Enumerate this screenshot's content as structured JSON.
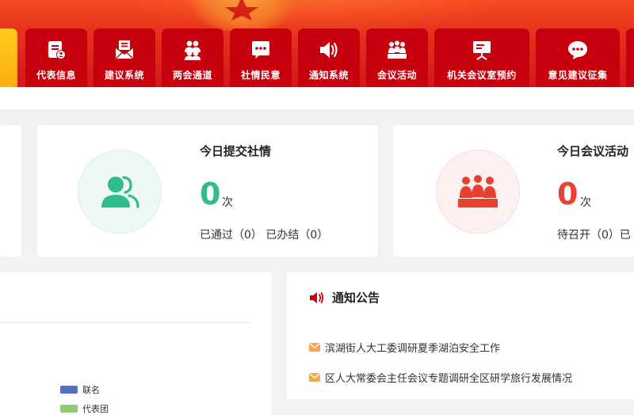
{
  "nav": {
    "items": [
      {
        "label": "代表信息",
        "icon": "representative-info-icon"
      },
      {
        "label": "建议系统",
        "icon": "proposal-envelope-icon"
      },
      {
        "label": "两会通道",
        "icon": "group-people-icon"
      },
      {
        "label": "社情民意",
        "icon": "chat-dots-icon"
      },
      {
        "label": "通知系统",
        "icon": "speaker-icon"
      },
      {
        "label": "会议活动",
        "icon": "meeting-audience-icon"
      },
      {
        "label": "机关会议室预约",
        "icon": "presentation-board-icon"
      },
      {
        "label": "意见建议征集",
        "icon": "comment-bubble-icon"
      }
    ]
  },
  "cards": {
    "social": {
      "title": "今日提交社情",
      "count": "0",
      "unit": "次",
      "status": "已通过（0） 已办结（0）",
      "color": "#2fbd8a",
      "icon": "people-icon"
    },
    "meeting": {
      "title": "今日会议活动",
      "count": "0",
      "unit": "次",
      "status": "待召开（0）已",
      "color": "#e8412e",
      "icon": "meeting-icon"
    }
  },
  "chart": {
    "legend": [
      {
        "label": "联名",
        "color": "#5470c6"
      },
      {
        "label": "代表团",
        "color": "#91cc75"
      }
    ]
  },
  "notices": {
    "title": "通知公告",
    "items": [
      "滨湖街人大工委调研夏季湖泊安全工作",
      "区人大常委会主任会议专题调研全区研学旅行发展情况"
    ]
  },
  "colors": {
    "nav_red": "#c6000d",
    "accent_yellow": "#ffb81a"
  }
}
